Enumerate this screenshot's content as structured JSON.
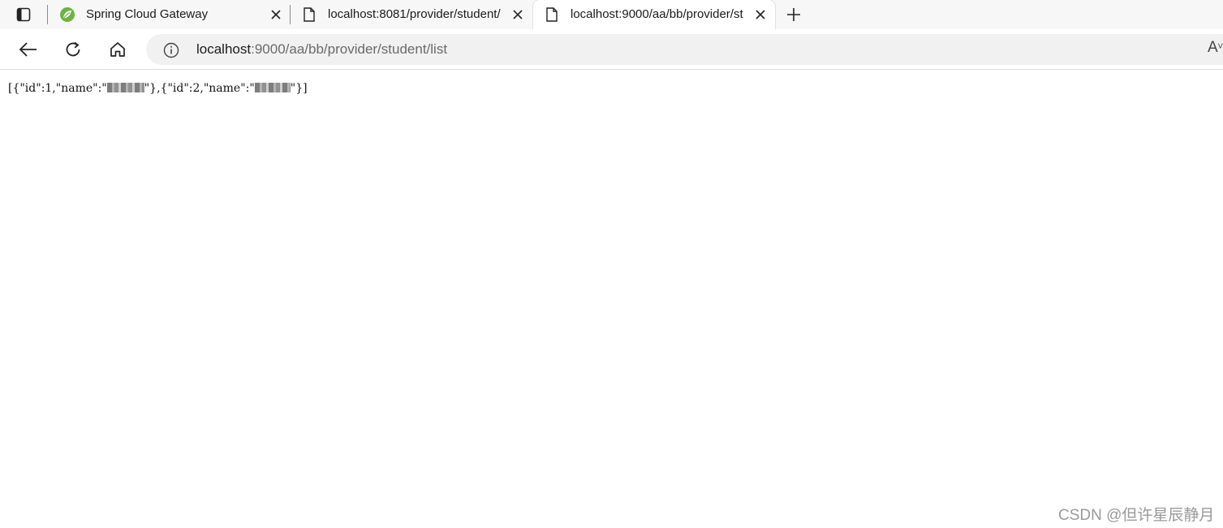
{
  "tabs": [
    {
      "title": "Spring Cloud Gateway",
      "favicon": "spring-leaf-icon"
    },
    {
      "title": "localhost:8081/provider/student/",
      "favicon": "page-icon"
    },
    {
      "title": "localhost:9000/aa/bb/provider/st",
      "favicon": "page-icon",
      "active": true
    }
  ],
  "address": {
    "host": "localhost",
    "rest": ":9000/aa/bb/provider/student/list"
  },
  "content": {
    "part1": "[{\"id\":1,\"name\":\"",
    "part2": "\"},{\"id\":2,\"name\":\"",
    "part3": "\"}]"
  },
  "watermark": "CSDN @但许星辰静月",
  "colors": {
    "accent": "#6db33f",
    "toolbar": "#ffffff",
    "tabstrip": "#f7f7f7"
  }
}
